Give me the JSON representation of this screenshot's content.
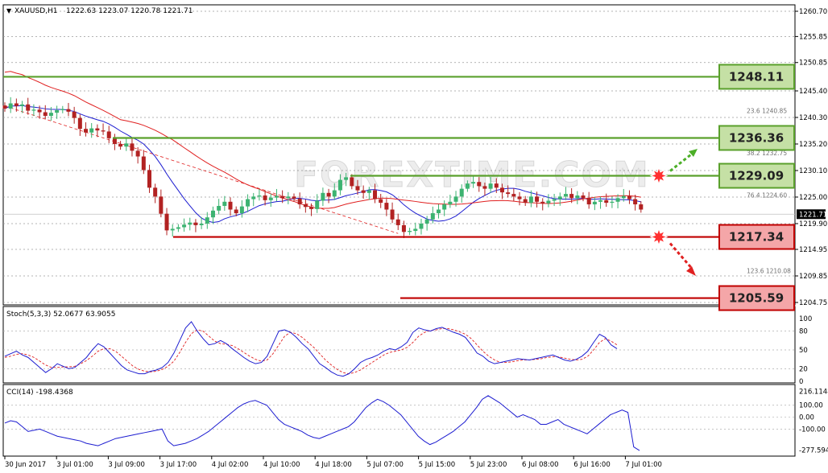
{
  "header": {
    "symbol": "XAUUSD,H1",
    "ohlc": "1222.63 1223.07 1220.78 1221.71"
  },
  "watermark": "FOREXTIME.COM",
  "colors": {
    "bull": "#3cb371",
    "bear": "#b22222",
    "support": "#c00000",
    "resistance": "#5aa02c",
    "ma_fast": "#1c1cd0",
    "ma_slow": "#e02020",
    "trend": "#e02020",
    "stoch_main": "#1c1cd0",
    "stoch_signal": "#e02020",
    "cci": "#1c1cd0"
  },
  "chart_data": [
    {
      "type": "candlestick",
      "panel": "price",
      "ylim": [
        1204.75,
        1260.7
      ],
      "current_price": "1221.71",
      "y_ticks": [
        "1260.70",
        "1255.85",
        "1250.85",
        "1245.40",
        "1240.30",
        "1235.20",
        "1230.10",
        "1225.00",
        "1219.90",
        "1214.95",
        "1209.85",
        "1204.75"
      ],
      "fib_labels": [
        {
          "label": "23.6  1240.85",
          "value": 1240.85
        },
        {
          "label": "38.2  1232.75",
          "value": 1232.75
        },
        {
          "label": "76.4  1224.60",
          "value": 1224.6
        },
        {
          "label": "123.6  1210.08",
          "value": 1210.08
        }
      ],
      "levels": [
        {
          "label": "1248.11",
          "value": 1248.11,
          "kind": "resistance"
        },
        {
          "label": "1236.36",
          "value": 1236.36,
          "kind": "resistance"
        },
        {
          "label": "1229.09",
          "value": 1229.09,
          "kind": "resistance"
        },
        {
          "label": "1217.34",
          "value": 1217.34,
          "kind": "support"
        },
        {
          "label": "1205.59",
          "value": 1205.59,
          "kind": "support"
        }
      ],
      "closes": [
        1242,
        1243,
        1242.5,
        1242.8,
        1241.6,
        1241.8,
        1241.3,
        1240.6,
        1241.2,
        1241.7,
        1241.9,
        1241.4,
        1240.2,
        1238.1,
        1237.4,
        1238.2,
        1237.8,
        1237.6,
        1236.3,
        1235.2,
        1234.7,
        1235.3,
        1233.9,
        1232.8,
        1230.2,
        1226.8,
        1225.1,
        1221.8,
        1218.6,
        1218.9,
        1219.2,
        1219.7,
        1220.1,
        1219.6,
        1219.9,
        1221.1,
        1222.4,
        1223.3,
        1224.1,
        1222.6,
        1221.9,
        1223.2,
        1224.6,
        1225.1,
        1225.3,
        1224.4,
        1224.9,
        1225.2,
        1224.8,
        1225.1,
        1224.7,
        1223.6,
        1223.1,
        1222.7,
        1224.3,
        1225.8,
        1225.1,
        1226.3,
        1228.3,
        1228.8,
        1227.1,
        1226.3,
        1225.8,
        1226.3,
        1224.6,
        1223.9,
        1222.6,
        1220.7,
        1219.6,
        1218.3,
        1218.5,
        1218.9,
        1219.9,
        1220.7,
        1221.9,
        1222.6,
        1223.6,
        1224.1,
        1225.1,
        1226.6,
        1227.6,
        1227.9,
        1227.1,
        1226.6,
        1227.6,
        1226.8,
        1225.9,
        1225.6,
        1225.1,
        1224.6,
        1223.9,
        1225.1,
        1224.1,
        1223.8,
        1224.3,
        1224.6,
        1225.1,
        1225.6,
        1224.8,
        1225.3,
        1224.8,
        1223.6,
        1224.1,
        1224.4,
        1223.9,
        1224.1,
        1224.8,
        1225.2,
        1224.6,
        1223.6,
        1222.6
      ],
      "x_labels": [
        "30 Jun 2017",
        "3 Jul 01:00",
        "3 Jul 09:00",
        "3 Jul 17:00",
        "4 Jul 02:00",
        "4 Jul 10:00",
        "4 Jul 18:00",
        "5 Jul 07:00",
        "5 Jul 15:00",
        "5 Jul 23:00",
        "6 Jul 08:00",
        "6 Jul 16:00",
        "7 Jul 01:00"
      ]
    },
    {
      "type": "line",
      "panel": "stochastic",
      "title": "Stoch(5,3,3) 52.0677 63.9055",
      "ylim": [
        0,
        100
      ],
      "y_ticks": [
        "100",
        "80",
        "50",
        "20",
        "0"
      ],
      "main": [
        40,
        44,
        48,
        42,
        38,
        30,
        22,
        14,
        20,
        28,
        24,
        20,
        22,
        30,
        38,
        50,
        60,
        55,
        45,
        35,
        25,
        18,
        15,
        12,
        12,
        16,
        18,
        22,
        30,
        45,
        65,
        85,
        95,
        80,
        68,
        58,
        60,
        65,
        60,
        52,
        45,
        38,
        32,
        28,
        30,
        40,
        60,
        80,
        82,
        78,
        70,
        60,
        52,
        40,
        28,
        22,
        15,
        10,
        8,
        12,
        20,
        30,
        35,
        38,
        42,
        48,
        52,
        50,
        55,
        62,
        78,
        85,
        82,
        80,
        84,
        86,
        82,
        78,
        75,
        70,
        58,
        45,
        40,
        32,
        28,
        30,
        32,
        34,
        36,
        35,
        34,
        36,
        38,
        40,
        42,
        38,
        34,
        32,
        35,
        40,
        48,
        62,
        75,
        70,
        58,
        52
      ],
      "signal": [
        38,
        40,
        43,
        44,
        42,
        38,
        32,
        26,
        22,
        22,
        23,
        23,
        24,
        28,
        33,
        40,
        48,
        52,
        52,
        48,
        40,
        32,
        24,
        19,
        16,
        15,
        16,
        19,
        24,
        32,
        46,
        62,
        76,
        82,
        80,
        72,
        64,
        60,
        59,
        57,
        52,
        46,
        40,
        35,
        32,
        34,
        44,
        58,
        72,
        78,
        76,
        70,
        62,
        54,
        44,
        34,
        26,
        19,
        14,
        12,
        14,
        18,
        24,
        30,
        36,
        42,
        46,
        48,
        50,
        54,
        62,
        72,
        78,
        81,
        82,
        84,
        84,
        82,
        79,
        75,
        68,
        58,
        48,
        40,
        34,
        30,
        30,
        31,
        33,
        34,
        34,
        35,
        36,
        38,
        39,
        39,
        37,
        35,
        34,
        35,
        40,
        50,
        62,
        68,
        64,
        58
      ]
    },
    {
      "type": "line",
      "panel": "cci",
      "title": "CCI(14) -198.4368",
      "ylim": [
        -300,
        240
      ],
      "y_ticks": [
        "216.1148",
        "100.00",
        "0.00",
        "-100.00",
        "-277.5945"
      ],
      "values": [
        -50,
        -30,
        -40,
        -80,
        -120,
        -110,
        -100,
        -120,
        -140,
        -160,
        -170,
        -180,
        -190,
        -200,
        -220,
        -230,
        -240,
        -220,
        -200,
        -180,
        -170,
        -160,
        -150,
        -140,
        -130,
        -120,
        -110,
        -100,
        -200,
        -240,
        -230,
        -220,
        -200,
        -180,
        -150,
        -120,
        -80,
        -40,
        0,
        40,
        80,
        110,
        130,
        140,
        120,
        100,
        40,
        -20,
        -60,
        -80,
        -100,
        -120,
        -150,
        -170,
        -180,
        -160,
        -140,
        -120,
        -100,
        -80,
        -40,
        20,
        80,
        120,
        150,
        130,
        100,
        60,
        20,
        -40,
        -100,
        -160,
        -200,
        -230,
        -210,
        -180,
        -150,
        -120,
        -80,
        -40,
        20,
        80,
        150,
        180,
        150,
        120,
        80,
        40,
        0,
        20,
        0,
        -20,
        -60,
        -60,
        -40,
        -20,
        -60,
        -80,
        -100,
        -120,
        -140,
        -100,
        -60,
        -20,
        20,
        40,
        60,
        40,
        -250,
        -280
      ]
    }
  ]
}
